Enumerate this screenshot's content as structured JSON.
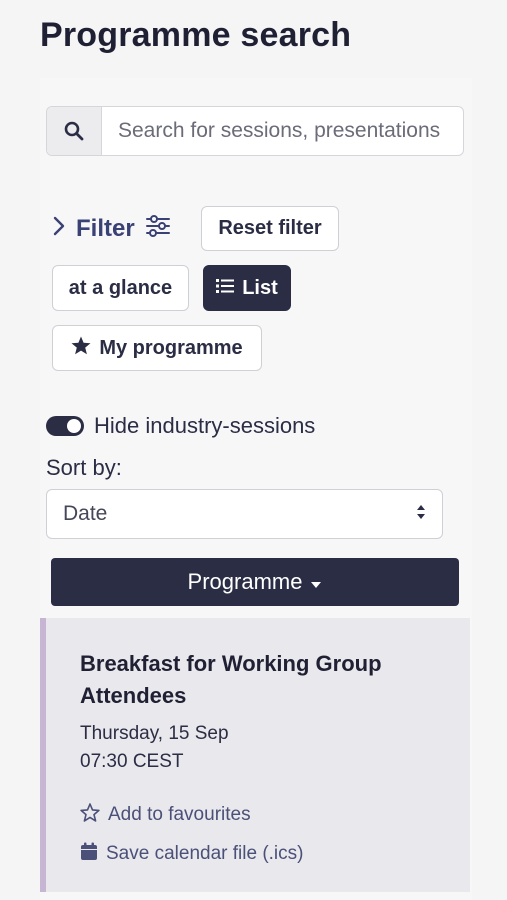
{
  "page": {
    "title": "Programme search"
  },
  "search": {
    "placeholder": "Search for sessions, presentations"
  },
  "filter": {
    "label": "Filter",
    "reset_label": "Reset filter"
  },
  "views": {
    "glance_label": "at a glance",
    "list_label": "List",
    "my_programme_label": "My programme"
  },
  "industry_toggle": {
    "label": "Hide industry-sessions",
    "checked": true
  },
  "sort": {
    "label": "Sort by:",
    "selected": "Date"
  },
  "programme_button": {
    "label": "Programme"
  },
  "session_card": {
    "title": "Breakfast for Working Group Attendees",
    "day": "Thursday, 15 Sep",
    "time": "07:30 CEST",
    "favourite_label": "Add to favourites",
    "calendar_label": "Save calendar file (.ics)"
  },
  "colors": {
    "primary_dark": "#2b2d45",
    "accent_link": "#3a4275",
    "card_border": "#c6b6d3"
  }
}
